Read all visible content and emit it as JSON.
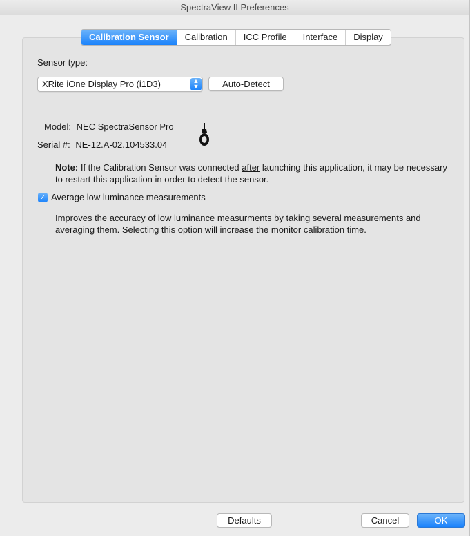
{
  "window": {
    "title": "SpectraView II Preferences"
  },
  "tabs": [
    {
      "label": "Calibration Sensor",
      "active": true
    },
    {
      "label": "Calibration",
      "active": false
    },
    {
      "label": "ICC Profile",
      "active": false
    },
    {
      "label": "Interface",
      "active": false
    },
    {
      "label": "Display",
      "active": false
    }
  ],
  "sensor": {
    "type_label": "Sensor type:",
    "selected": "XRite iOne Display Pro (i1D3)",
    "auto_detect_label": "Auto-Detect",
    "model_label": "Model:",
    "model_value": "NEC SpectraSensor Pro",
    "serial_label": "Serial #:",
    "serial_value": "NE-12.A-02.104533.04",
    "icon": "sensor-icon"
  },
  "note": {
    "prefix": "Note:",
    "text_before": " If the Calibration Sensor was connected ",
    "emphasis": "after",
    "text_after": " launching this application, it may be necessary to restart this application in order to detect the sensor."
  },
  "average": {
    "label": "Average low luminance measurements",
    "checked": true,
    "description": "Improves the accuracy of low luminance measurments by taking several measurements and averaging them. Selecting this option will increase the monitor calibration time."
  },
  "footer": {
    "defaults_label": "Defaults",
    "cancel_label": "Cancel",
    "ok_label": "OK"
  },
  "colors": {
    "accent": "#1a82fb",
    "panel": "#e4e4e4",
    "window": "#ececec"
  }
}
